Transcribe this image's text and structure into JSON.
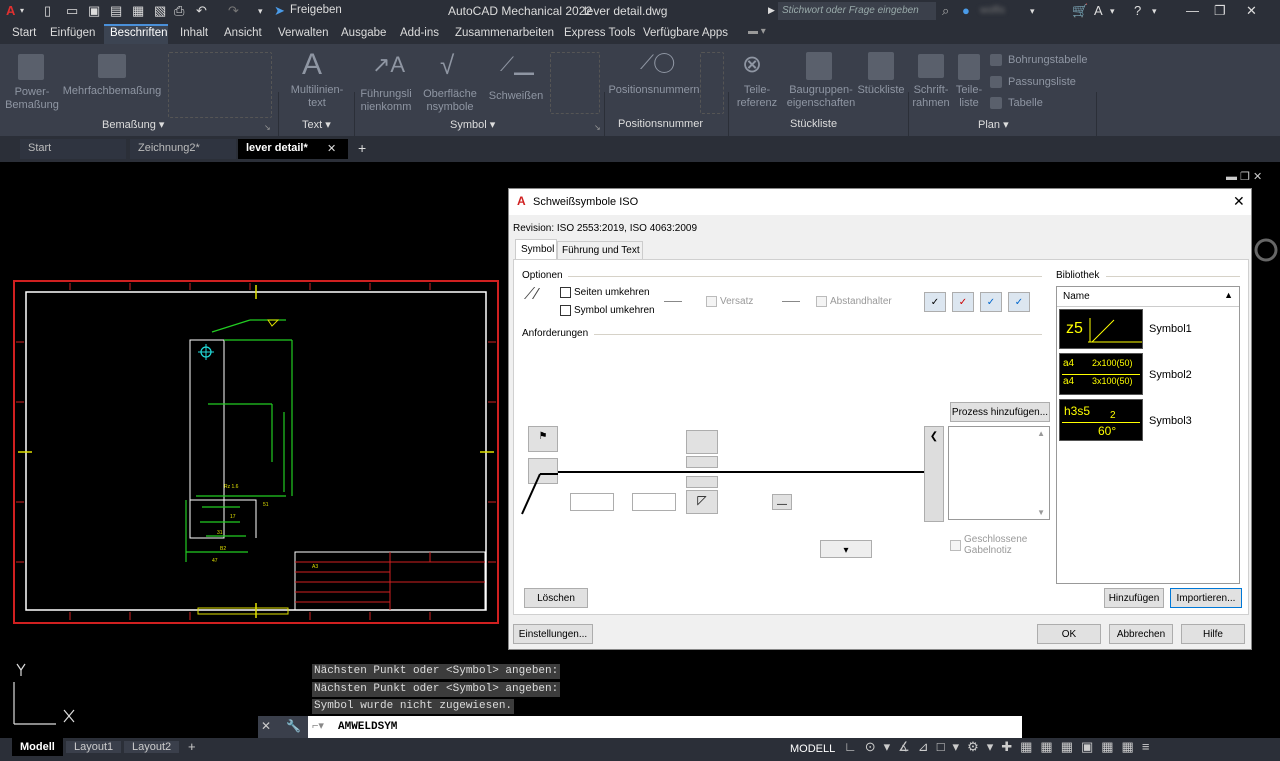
{
  "app": {
    "title": "AutoCAD Mechanical 2022",
    "file": "lever detail.dwg",
    "share": "Freigeben",
    "search_placeholder": "Stichwort oder Frage eingeben",
    "user": "wolfis"
  },
  "menu": [
    "Start",
    "Einfügen",
    "Beschriften",
    "Inhalt",
    "Ansicht",
    "Verwalten",
    "Ausgabe",
    "Add-ins",
    "Zusammenarbeiten",
    "Express Tools",
    "Verfügbare Apps"
  ],
  "ribbon": {
    "tools": {
      "power": "Power-\nBemaßung",
      "mehrfach": "Mehrfachbemaßung",
      "multilinien": "Multilinien-\ntext",
      "fuehrung": "Führungsli\nnienkomm",
      "oberflaeche": "Oberfläche\nnsymbole",
      "schweissen": "Schweißen",
      "position": "Positionsnummern",
      "teileref": "Teile-\nreferenz",
      "baugruppen": "Baugruppen-\neigenschaften",
      "stueckliste": "Stückliste",
      "schriftrahmen": "Schrift-\nrahmen",
      "teileliste": "Teile-\nliste",
      "bohrung": "Bohrungstabelle",
      "passung": "Passungsliste",
      "tabelle": "Tabelle"
    },
    "groups": {
      "bemassung": "Bemaßung",
      "text": "Text",
      "symbol": "Symbol",
      "positionsnummer": "Positionsnummer",
      "stueckliste": "Stückliste",
      "plan": "Plan"
    }
  },
  "doc_tabs": [
    "Start",
    "Zeichnung2*",
    "lever detail*"
  ],
  "dialog": {
    "title": "Schweißsymbole ISO",
    "revision": "Revision: ISO 2553:2019, ISO 4063:2009",
    "tabs": [
      "Symbol",
      "Führung und Text"
    ],
    "optionen": "Optionen",
    "seiten": "Seiten umkehren",
    "symbol_umk": "Symbol umkehren",
    "versatz": "Versatz",
    "abstand": "Abstandhalter",
    "anforderungen": "Anforderungen",
    "prozess": "Prozess hinzufügen...",
    "gabel": "Geschlossene\nGabelnotiz",
    "loeschen": "Löschen",
    "einstellungen": "Einstellungen...",
    "bibliothek": "Bibliothek",
    "name_col": "Name",
    "library": [
      {
        "name": "Symbol1",
        "preview": "z5"
      },
      {
        "name": "Symbol2",
        "preview1": "a4",
        "preview2": "2x100(50)",
        "preview3": "a4",
        "preview4": "3x100(50)"
      },
      {
        "name": "Symbol3",
        "preview1": "h3s5",
        "preview2": "2",
        "preview3": "60°"
      }
    ],
    "hinzufuegen": "Hinzufügen",
    "importieren": "Importieren...",
    "ok": "OK",
    "abbrechen": "Abbrechen",
    "hilfe": "Hilfe"
  },
  "commands": [
    "Nächsten Punkt oder <Symbol> angeben:",
    "Nächsten Punkt oder <Symbol> angeben:",
    "Symbol wurde nicht zugewiesen."
  ],
  "command_input": "AMWELDSYM",
  "layout_tabs": [
    "Modell",
    "Layout1",
    "Layout2"
  ],
  "status": {
    "model": "MODELL"
  },
  "drawing": {
    "dim_a": "Rz 1.6",
    "dim_17": "17",
    "dim_31": "31",
    "dim_b": "B2",
    "dim_47": "47",
    "dim_51": "51",
    "title_a3": "A3"
  }
}
